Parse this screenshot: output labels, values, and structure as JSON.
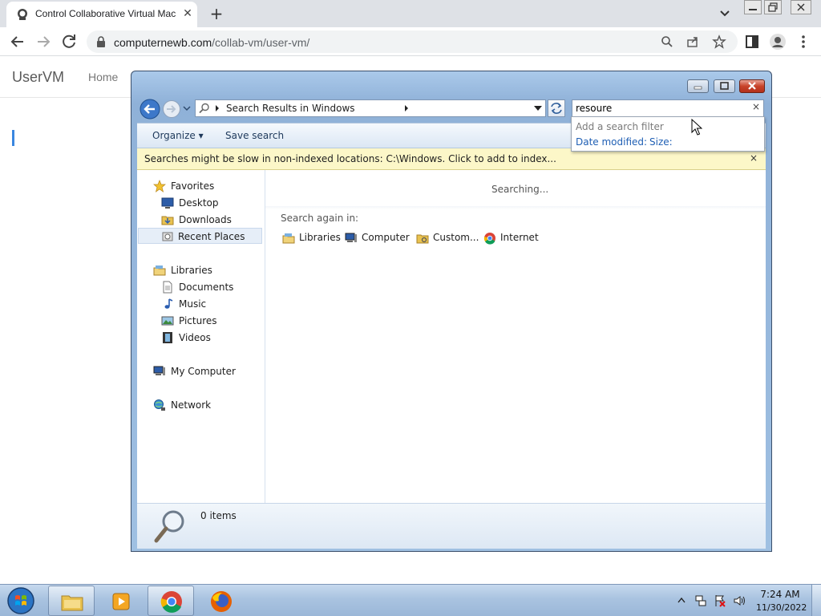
{
  "browser": {
    "tab_title": "Control Collaborative Virtual Machine",
    "url_host": "computernewb.com",
    "url_path": "/collab-vm/user-vm/",
    "new_tab_glyph": "+",
    "close_glyph": "✕"
  },
  "page": {
    "brand": "UserVM",
    "nav_home": "Home"
  },
  "explorer": {
    "address_text": "Search Results in Windows",
    "search_value": "resoure",
    "search_clear": "×",
    "cmd_organize": "Organize ▾",
    "cmd_save_search": "Save search",
    "infobar_text": "Searches might be slow in non-indexed locations: C:\\Windows. Click to add to index...",
    "infobar_close": "×",
    "nav": {
      "favorites": "Favorites",
      "desktop": "Desktop",
      "downloads": "Downloads",
      "recent_places": "Recent Places",
      "libraries": "Libraries",
      "documents": "Documents",
      "music": "Music",
      "pictures": "Pictures",
      "videos": "Videos",
      "my_computer": "My Computer",
      "network": "Network"
    },
    "status": "Searching...",
    "search_again_label": "Search again in:",
    "search_again": {
      "libraries": "Libraries",
      "computer": "Computer",
      "custom": "Custom...",
      "internet": "Internet"
    },
    "items_count": "0 items",
    "dropdown": {
      "title": "Add a search filter",
      "date_modified": "Date modified:",
      "size": "Size:"
    }
  },
  "taskbar": {
    "time": "7:24 AM",
    "date": "11/30/2022"
  },
  "colors": {
    "accent": "#3a87e0",
    "infobar": "#fcf7c8",
    "link": "#1f5fb4"
  }
}
